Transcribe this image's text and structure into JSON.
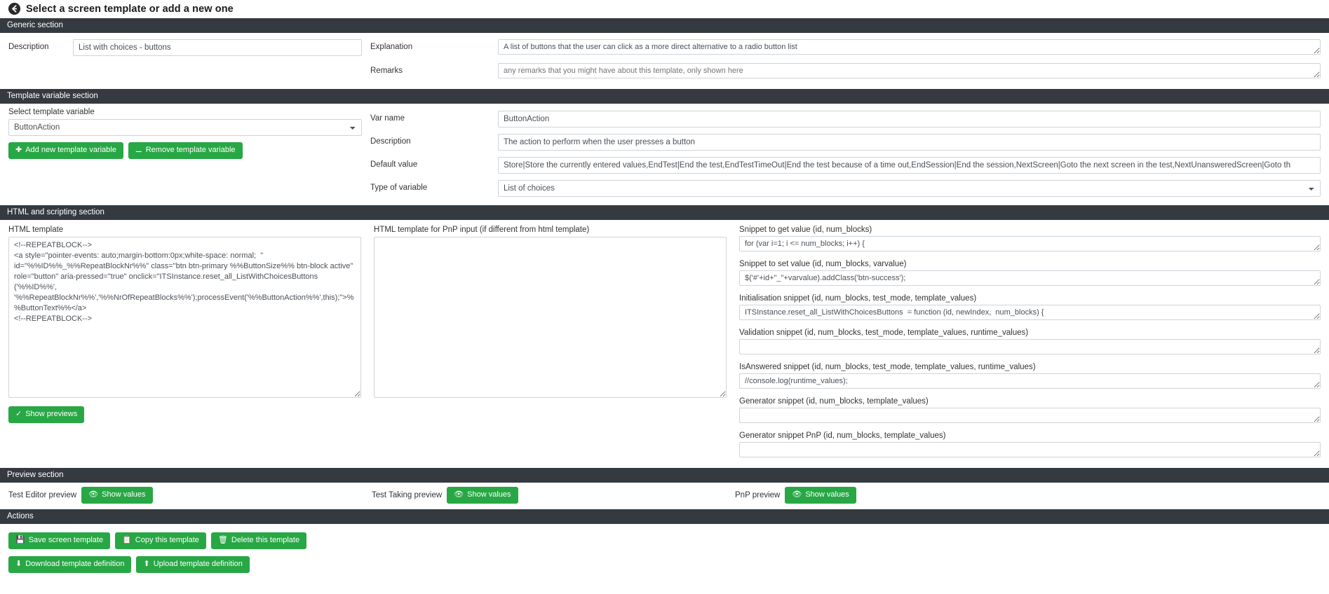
{
  "header": {
    "title": "Select a screen template or add a new one",
    "back_icon": "back-arrow-circle-icon"
  },
  "sections": {
    "generic": "Generic section",
    "template_variable": "Template variable section",
    "html_scripting": "HTML and scripting section",
    "preview": "Preview section",
    "actions": "Actions"
  },
  "generic": {
    "description_label": "Description",
    "description_value": "List with choices - buttons",
    "explanation_label": "Explanation",
    "explanation_value": "A list of buttons that the user can click as a more direct alternative to a radio button list",
    "remarks_label": "Remarks",
    "remarks_placeholder": "any remarks that you might have about this template, only shown here",
    "remarks_value": ""
  },
  "template_variable": {
    "select_label": "Select template variable",
    "select_value": "ButtonAction",
    "add_button": "Add new template variable",
    "remove_button": "Remove template variable",
    "var_name_label": "Var name",
    "var_name_value": "ButtonAction",
    "description_label": "Description",
    "description_value": "The action to perform when the user presses a button",
    "default_value_label": "Default value",
    "default_value": "Store|Store the currently entered values,EndTest|End the test,EndTestTimeOut|End the test because of a time out,EndSession|End the session,NextScreen|Goto the next screen in the test,NextUnansweredScreen|Goto th",
    "type_label": "Type of variable",
    "type_value": "List of choices"
  },
  "html_scripting": {
    "html_template_label": "HTML template",
    "html_template_value": "<!--REPEATBLOCK-->\n<a style=\"pointer-events: auto;margin-bottom:0px;white-space: normal;  \" id=\"%%ID%%_%%RepeatBlockNr%%\" class=\"btn btn-primary %%ButtonSize%% btn-block active\" role=\"button\" aria-pressed=\"true\" onclick=\"ITSInstance.reset_all_ListWithChoicesButtons ('%%ID%%', '%%RepeatBlockNr%%','%%NrOfRepeatBlocks%%');processEvent('%%ButtonAction%%',this);\">%%ButtonText%%</a>\n<!--REPEATBLOCK-->",
    "pnp_template_label": "HTML template for PnP input (if different from html template)",
    "pnp_template_value": "",
    "show_previews_button": "Show previews",
    "snippets": [
      {
        "label": "Snippet to get value (id, num_blocks)",
        "value": "for (var i=1; i <= num_blocks; i++) {"
      },
      {
        "label": "Snippet to set value (id, num_blocks, varvalue)",
        "value": "$('#'+id+\"_\"+varvalue).addClass('btn-success');"
      },
      {
        "label": "Initialisation snippet (id, num_blocks, test_mode, template_values)",
        "value": "ITSInstance.reset_all_ListWithChoicesButtons  = function (id, newIndex,  num_blocks) {"
      },
      {
        "label": "Validation snippet (id, num_blocks, test_mode, template_values, runtime_values)",
        "value": ""
      },
      {
        "label": "IsAnswered snippet (id, num_blocks, test_mode, template_values, runtime_values)",
        "value": "//console.log(runtime_values);"
      },
      {
        "label": "Generator snippet (id, num_blocks, template_values)",
        "value": ""
      },
      {
        "label": "Generator snippet PnP (id, num_blocks, template_values)",
        "value": ""
      }
    ]
  },
  "preview": {
    "test_editor_label": "Test Editor preview",
    "test_editor_button": "Show values",
    "test_taking_label": "Test Taking preview",
    "test_taking_button": "Show values",
    "pnp_label": "PnP preview",
    "pnp_button": "Show values"
  },
  "actions": {
    "save": "Save screen template",
    "copy": "Copy this template",
    "delete": "Delete this template",
    "download": "Download template definition",
    "upload": "Upload template definition"
  },
  "colors": {
    "section_bar": "#343a40",
    "button_green": "#28a745",
    "border": "#ced4da"
  }
}
